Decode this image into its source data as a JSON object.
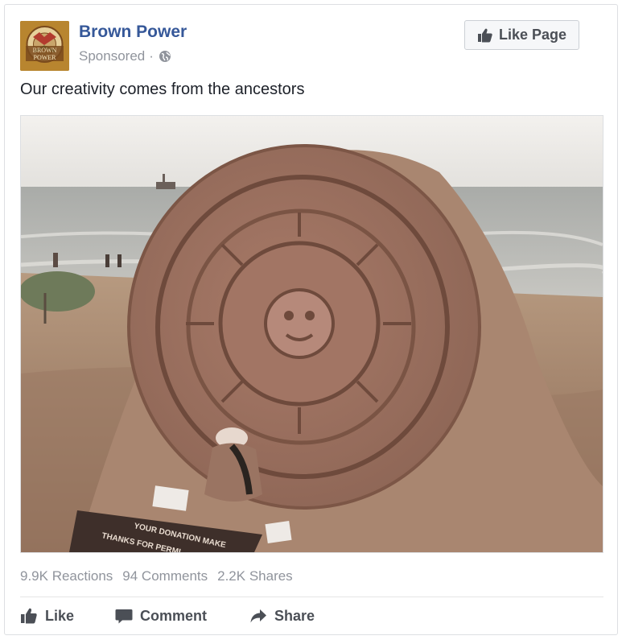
{
  "post": {
    "page_name": "Brown Power",
    "avatar_text_line1": "BROWN",
    "avatar_text_line2": "POWER",
    "sponsored_label": "Sponsored",
    "separator": "·",
    "audience_icon": "globe-icon",
    "like_page_label": "Like Page",
    "message": "Our creativity comes from the ancestors",
    "image_sign_text_line1": "YOUR DONATION MAKE",
    "image_sign_text_line2": "THANKS FOR PERMI"
  },
  "stats": {
    "reactions": "9.9K Reactions",
    "comments": "94 Comments",
    "shares": "2.2K Shares"
  },
  "actions": {
    "like_label": "Like",
    "comment_label": "Comment",
    "share_label": "Share"
  },
  "colors": {
    "link_blue": "#365899",
    "meta_grey": "#90949c",
    "text_dark": "#1d2129",
    "button_text": "#4b4f56"
  }
}
